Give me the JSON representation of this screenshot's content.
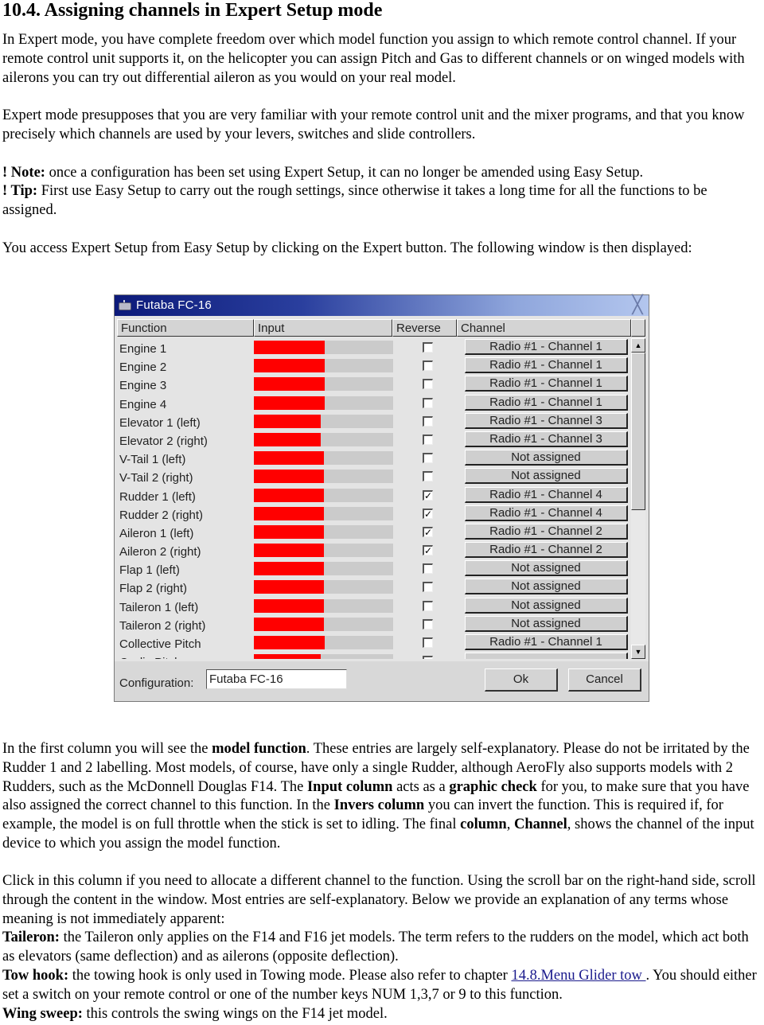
{
  "document": {
    "heading": "10.4. Assigning channels in Expert Setup mode",
    "para1": "In Expert mode, you have complete freedom over which model function you assign to which remote control channel. If your remote control unit supports it, on the helicopter you can assign Pitch and Gas to different channels or on winged models with ailerons you can try out differential aileron as you would on your real model.",
    "para2": "Expert mode presupposes that you are very familiar with your remote control unit and the mixer programs, and that you know precisely which channels are used by your levers, switches and slide controllers.",
    "note_prefix": "! ",
    "note_label": "Note:",
    "note_text": " once a configuration has been set using Expert Setup, it can no longer be amended using Easy Setup.",
    "tip_prefix": "! ",
    "tip_label": "Tip:",
    "tip_text": " First use Easy Setup to carry out the rough settings, since otherwise it takes a long time for all the functions to be assigned.",
    "para3": "You access Expert Setup from Easy Setup by clicking on the Expert button. The following window is then displayed:",
    "para4": {
      "t1": "In the first column you will see the ",
      "b1": "model function",
      "t2": ". These entries are largely self-explanatory. Please do not be irritated by the Rudder 1 and 2 labelling. Most models, of course, have only a single Rudder, although AeroFly also supports models with 2 Rudders, such as the McDonnell Douglas F14. The ",
      "b2": "Input column",
      "t3": " acts as a ",
      "b3": "graphic check",
      "t4": " for you, to make sure that you have also assigned the correct channel to this function. In the ",
      "b4": "Invers column",
      "t5": " you can invert the function. This is required if, for example, the model is on full throttle when the stick is set to idling. The final ",
      "b5": "column",
      "t6": ", ",
      "b6": "Channel",
      "t7": ", shows the channel of the input device to which you assign the model function."
    },
    "para5": "Click in this column if you need to allocate a different channel to the function. Using the scroll bar on the right-hand side, scroll through the content in the window. Most entries are self-explanatory. Below we provide an explanation of any terms whose meaning is not immediately apparent:",
    "taileron_label": "Taileron:",
    "taileron_text": " the Taileron only applies on the F14 and F16 jet models. The term refers to the rudders on the model, which act both as elevators (same deflection) and as ailerons (opposite deflection).",
    "towhook_label": "Tow hook:",
    "towhook_text1": " the towing hook is only used in Towing mode. Please also refer to chapter ",
    "towhook_link": "14.8.Menu Glider tow ",
    "towhook_text2": ". You should either set a switch on your remote control or one of the number keys NUM 1,3,7 or 9 to this function.",
    "wingsweep_label": "Wing sweep:",
    "wingsweep_text": " this controls the swing wings on the F14 jet model."
  },
  "dialog": {
    "title": "Futaba FC-16",
    "app_icon": "radio-transmitter-icon",
    "close_icon": "close-icon",
    "columns": [
      "Function",
      "Input",
      "Reverse",
      "Channel"
    ],
    "rows": [
      {
        "function": "Engine 1",
        "input_pct": 51,
        "reverse": false,
        "channel": "Radio #1 - Channel 1"
      },
      {
        "function": "Engine 2",
        "input_pct": 51,
        "reverse": false,
        "channel": "Radio #1 - Channel 1"
      },
      {
        "function": "Engine 3",
        "input_pct": 51,
        "reverse": false,
        "channel": "Radio #1 - Channel 1"
      },
      {
        "function": "Engine 4",
        "input_pct": 51,
        "reverse": false,
        "channel": "Radio #1 - Channel 1"
      },
      {
        "function": "Elevator 1 (left)",
        "input_pct": 48,
        "reverse": false,
        "channel": "Radio #1 - Channel 3"
      },
      {
        "function": "Elevator 2 (right)",
        "input_pct": 48,
        "reverse": false,
        "channel": "Radio #1 - Channel 3"
      },
      {
        "function": "V-Tail 1 (left)",
        "input_pct": 50,
        "reverse": false,
        "channel": "Not assigned"
      },
      {
        "function": "V-Tail 2 (right)",
        "input_pct": 50,
        "reverse": false,
        "channel": "Not assigned"
      },
      {
        "function": "Rudder 1 (left)",
        "input_pct": 50,
        "reverse": true,
        "channel": "Radio #1 - Channel 4"
      },
      {
        "function": "Rudder 2 (right)",
        "input_pct": 50,
        "reverse": true,
        "channel": "Radio #1 - Channel 4"
      },
      {
        "function": "Aileron 1 (left)",
        "input_pct": 50,
        "reverse": true,
        "channel": "Radio #1 - Channel 2"
      },
      {
        "function": "Aileron 2 (right)",
        "input_pct": 50,
        "reverse": true,
        "channel": "Radio #1 - Channel 2"
      },
      {
        "function": "Flap 1 (left)",
        "input_pct": 50,
        "reverse": false,
        "channel": "Not assigned"
      },
      {
        "function": "Flap 2 (right)",
        "input_pct": 50,
        "reverse": false,
        "channel": "Not assigned"
      },
      {
        "function": "Taileron 1 (left)",
        "input_pct": 50,
        "reverse": false,
        "channel": "Not assigned"
      },
      {
        "function": "Taileron 2 (right)",
        "input_pct": 50,
        "reverse": false,
        "channel": "Not assigned"
      },
      {
        "function": "Collective Pitch",
        "input_pct": 51,
        "reverse": false,
        "channel": "Radio #1 - Channel 1"
      },
      {
        "function": "Cyclic Pitch",
        "input_pct": 48,
        "reverse": false,
        "channel": ""
      }
    ],
    "scroll_up_icon": "arrow-up-icon",
    "scroll_down_icon": "arrow-down-icon",
    "configuration_label": "Configuration:",
    "configuration_value": "Futaba FC-16",
    "ok_label": "Ok",
    "cancel_label": "Cancel",
    "colors": {
      "input_fill": "#ff0000",
      "input_track": "#cbcbcb",
      "titlebar_start": "#0c1a7a",
      "titlebar_end": "#b3c6ee"
    }
  }
}
